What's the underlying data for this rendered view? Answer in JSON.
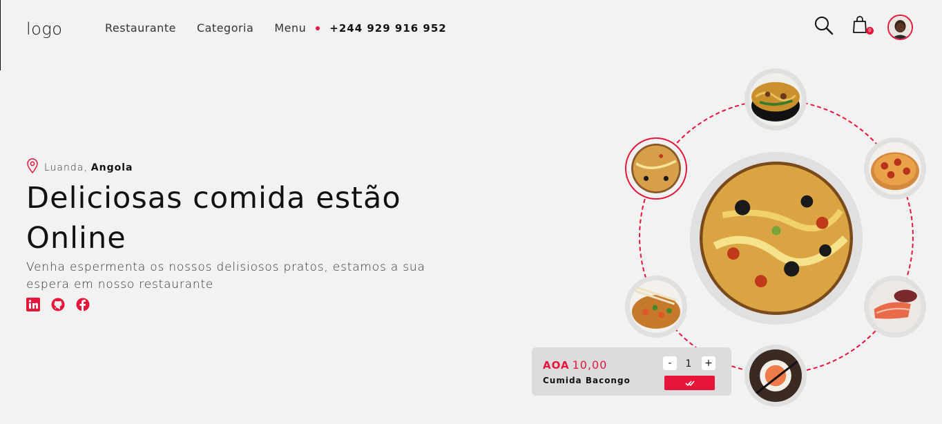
{
  "header": {
    "logo": "logo",
    "nav": [
      {
        "label": "Restaurante"
      },
      {
        "label": "Categoria"
      },
      {
        "label": "Menu"
      }
    ],
    "phone": "+244 929 916 952",
    "cart_count": "0",
    "icons": [
      "search-icon",
      "shopping-bag-icon",
      "user-avatar"
    ]
  },
  "hero": {
    "location_city": "Luanda,",
    "location_country": "Angola",
    "title": "Deliciosas comida estão Online",
    "subtitle": "Venha espermenta os nossos delisiosos pratos, estamos a sua espera em nosso restaurante",
    "social": [
      "linkedin-icon",
      "github-icon",
      "facebook-icon"
    ]
  },
  "product": {
    "currency": "AOA",
    "price": "10,00",
    "name": "Cumida Bacongo",
    "quantity": "1",
    "minus_label": "-",
    "plus_label": "+"
  },
  "colors": {
    "accent": "#e8153a",
    "background": "#f2f2f2"
  }
}
